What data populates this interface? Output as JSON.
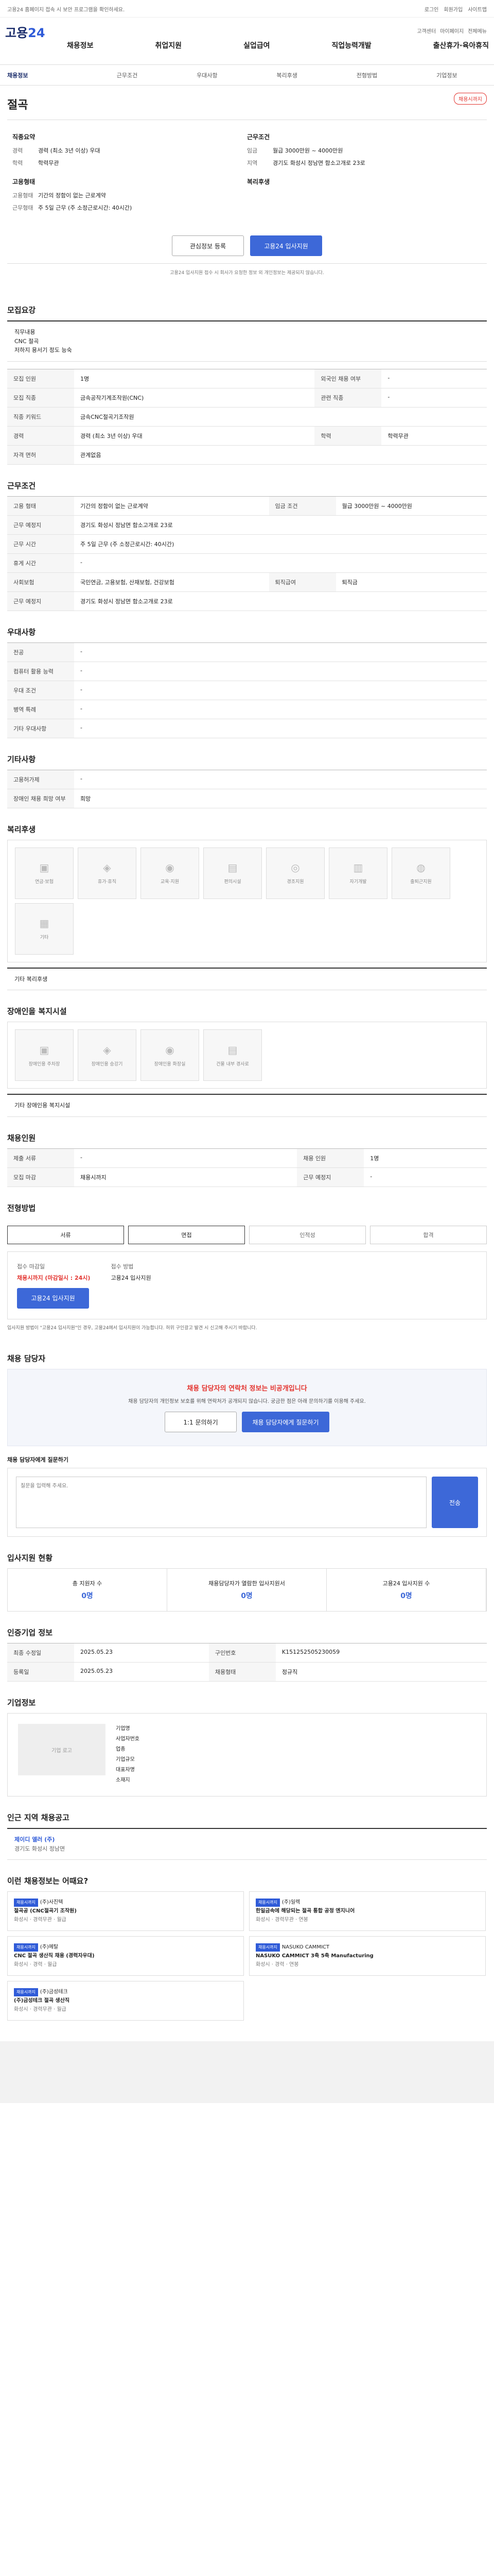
{
  "topbar": {
    "notice": "고용24 홈페이지 접속 시 보안 프로그램을 확인하세요.",
    "links": [
      "로그인",
      "회원가입",
      "사이트맵"
    ]
  },
  "header": {
    "logo_main": "고용",
    "logo_num": "24",
    "util": [
      "고객센터",
      "마이페이지",
      "전체메뉴"
    ],
    "gnb": [
      "채용정보",
      "취업지원",
      "실업급여",
      "직업능력개발",
      "출산휴가·육아휴직"
    ]
  },
  "subnav": [
    "채용정보",
    "근무조건",
    "우대사항",
    "복리후생",
    "전형방법",
    "기업정보"
  ],
  "job": {
    "title": "절곡",
    "badge": "채용시까지",
    "company_section": "직종요약",
    "left": [
      [
        "경력",
        "경력 (최소 3년 이상) 우대"
      ],
      [
        "학력",
        "학력무관"
      ]
    ],
    "right": [
      [
        "임금",
        "월급 3000만원 ~ 4000만원"
      ],
      [
        "지역",
        "경기도 화성시 정남면 함소고개로 23로"
      ]
    ],
    "left2_title": "고용형태",
    "left2": [
      [
        "고용형태",
        "기간의 정함이 없는 근로계약"
      ],
      [
        "근무형태",
        "주 5일 근무 (주 소정근로시간: 40시간)"
      ]
    ],
    "right2_title": "복리후생",
    "right2": []
  },
  "actions": {
    "favorite": "관심정보 등록",
    "apply": "고용24 입사지원"
  },
  "actions_note": "고용24 입사지원 접수 시 회사가 요청한 정보 외 개인정보는 제공되지 않습니다.",
  "sections": {
    "summary": "모집요강",
    "summary_text": "직무내용\nCNC 절곡\n저하지 용서기 정도 능숙",
    "conditions": "근무조건",
    "prefer": "우대사항",
    "etc": "기타사항",
    "welfare": "복리후생",
    "welfare_etc": "기타 복리후생",
    "disabled": "장애인을 복지시설",
    "disabled_etc": "기타 장애인용 복지시설",
    "recruit": "채용인원",
    "method": "전형방법",
    "contact": "채용 담당자",
    "stats": "입사지원 현황",
    "info": "인증기업 정보",
    "company": "기업정보",
    "nearby": "인근 지역 채용공고",
    "recommend": "이런 채용정보는 어때요?"
  },
  "summary_rows": [
    [
      "모집 인원",
      "1명",
      "외국인 채용 여부",
      "-"
    ],
    [
      "모집 직종",
      "금속공작기계조작원(CNC)",
      "관련 직종",
      "-"
    ],
    [
      "직종 키워드",
      "금속CNC절곡기조작원",
      "",
      ""
    ],
    [
      "경력",
      "경력 (최소 3년 이상) 우대",
      "학력",
      "학력무관"
    ],
    [
      "자격 면허",
      "관계없음",
      "",
      ""
    ]
  ],
  "cond_rows": [
    [
      "고용 형태",
      "기간의 정함이 없는 근로계약",
      "임금 조건",
      "월급 3000만원 ~ 4000만원"
    ],
    [
      "근무 예정지",
      "경기도 화성시 정남면 함소고개로 23로",
      "",
      ""
    ],
    [
      "근무 시간",
      "주 5일 근무 (주 소정근로시간: 40시간)",
      "",
      ""
    ],
    [
      "휴게 시간",
      "-",
      "",
      ""
    ],
    [
      "사회보험",
      "국민연금, 고용보험, 산재보험, 건강보험",
      "퇴직급여",
      "퇴직금"
    ],
    [
      "근무 예정지",
      "경기도 화성시 정남면 함소고개로 23로",
      "",
      ""
    ]
  ],
  "prefer_rows": [
    [
      "전공",
      "-"
    ],
    [
      "컴퓨터 활용 능력",
      "-"
    ],
    [
      "우대 조건",
      "-"
    ],
    [
      "병역 특례",
      "-"
    ],
    [
      "기타 우대사항",
      "-"
    ]
  ],
  "etc_rows": [
    [
      "고용허가제",
      "-"
    ],
    [
      "장애인 채용 희망 여부",
      "희망"
    ]
  ],
  "welfare_cards": [
    "연금·보험",
    "휴가·휴직",
    "교육·지원",
    "편의시설",
    "경조지원",
    "자기개발",
    "출퇴근지원",
    "기타"
  ],
  "disabled_cards": [
    "장애인용 주차장",
    "장애인용 승강기",
    "장애인용 화장실",
    "건물 내부 경사로"
  ],
  "recruit_rows": [
    [
      "제출 서류",
      "-",
      "채용 인원",
      "1명"
    ],
    [
      "모집 마감",
      "채용시까지",
      "근무 예정지",
      "-"
    ]
  ],
  "steps": [
    "서류",
    "면접",
    "인적성",
    "합격"
  ],
  "recruit_box": {
    "deadline_label": "접수 마감일",
    "deadline": "채용시까지 (마감일시 : 24시)",
    "method_label": "접수 방법",
    "method": "고용24 입사지원",
    "apply": "고용24 입사지원"
  },
  "notes": "입사지원 방법이 \"고용24 입사지원\"인 경우, 고용24에서 입사지원이 가능합니다. 허위 구인광고 발견 시 신고해 주시기 바랍니다.",
  "contact": {
    "title": "채용 담당자의 연락처 정보는 비공개입니다",
    "desc": "채용 담당자의 개인정보 보호를 위해 연락처가 공개되지 않습니다. 궁금한 점은 아래 문의하기를 이용해 주세요.",
    "ask": "1:1 문의하기",
    "inquiry": "채용 담당자에게 질문하기"
  },
  "message": {
    "label": "채용 담당자에게 질문하기",
    "placeholder": "질문을 입력해 주세요.",
    "send": "전송"
  },
  "stats": [
    [
      "총 지원자 수",
      "0명"
    ],
    [
      "채용담당자가 열람한 입사지원서",
      "0명"
    ],
    [
      "고용24 입사지원 수",
      "0명"
    ]
  ],
  "info_rows": [
    [
      "최종 수정일",
      "2025.05.23",
      "구인번호",
      "K151252505230059"
    ],
    [
      "등록일",
      "2025.05.23",
      "채용형태",
      "정규직"
    ]
  ],
  "company": {
    "logo": "기업 로고",
    "name": "기업명",
    "rows": [
      "사업자번호",
      "업종",
      "기업규모",
      "대표자명",
      "소재지"
    ]
  },
  "nearby": {
    "title": "제이디 엘러 (주)",
    "desc": "경기도 화성시 정남면"
  },
  "recommend": [
    {
      "tag": "채용시까지",
      "company": "(주)사진텍",
      "title": "절곡공 (CNC절곡기 조작원)",
      "info": "화성시 · 경력무관 · 월급"
    },
    {
      "tag": "채용시까지",
      "company": "(주)일렉",
      "title": "한일금속에 해당되는 절곡 통합 공정 엔지니어",
      "info": "화성시 · 경력무관 · 연봉"
    },
    {
      "tag": "채용시까지",
      "company": "(주)메탈",
      "title": "CNC 절곡 생산직 채용 (경력자우대)",
      "info": "화성시 · 경력 · 월급"
    },
    {
      "tag": "채용시까지",
      "company": "NASUKO CAMMICT",
      "title": "NASUKO CAMMICT 3축 5축 Manufacturing",
      "info": "화성시 · 경력 · 연봉"
    },
    {
      "tag": "채용시까지",
      "company": "(주)금성테크",
      "title": "(주)금성테크 절곡 생산직",
      "info": "화성시 · 경력무관 · 월급"
    }
  ]
}
